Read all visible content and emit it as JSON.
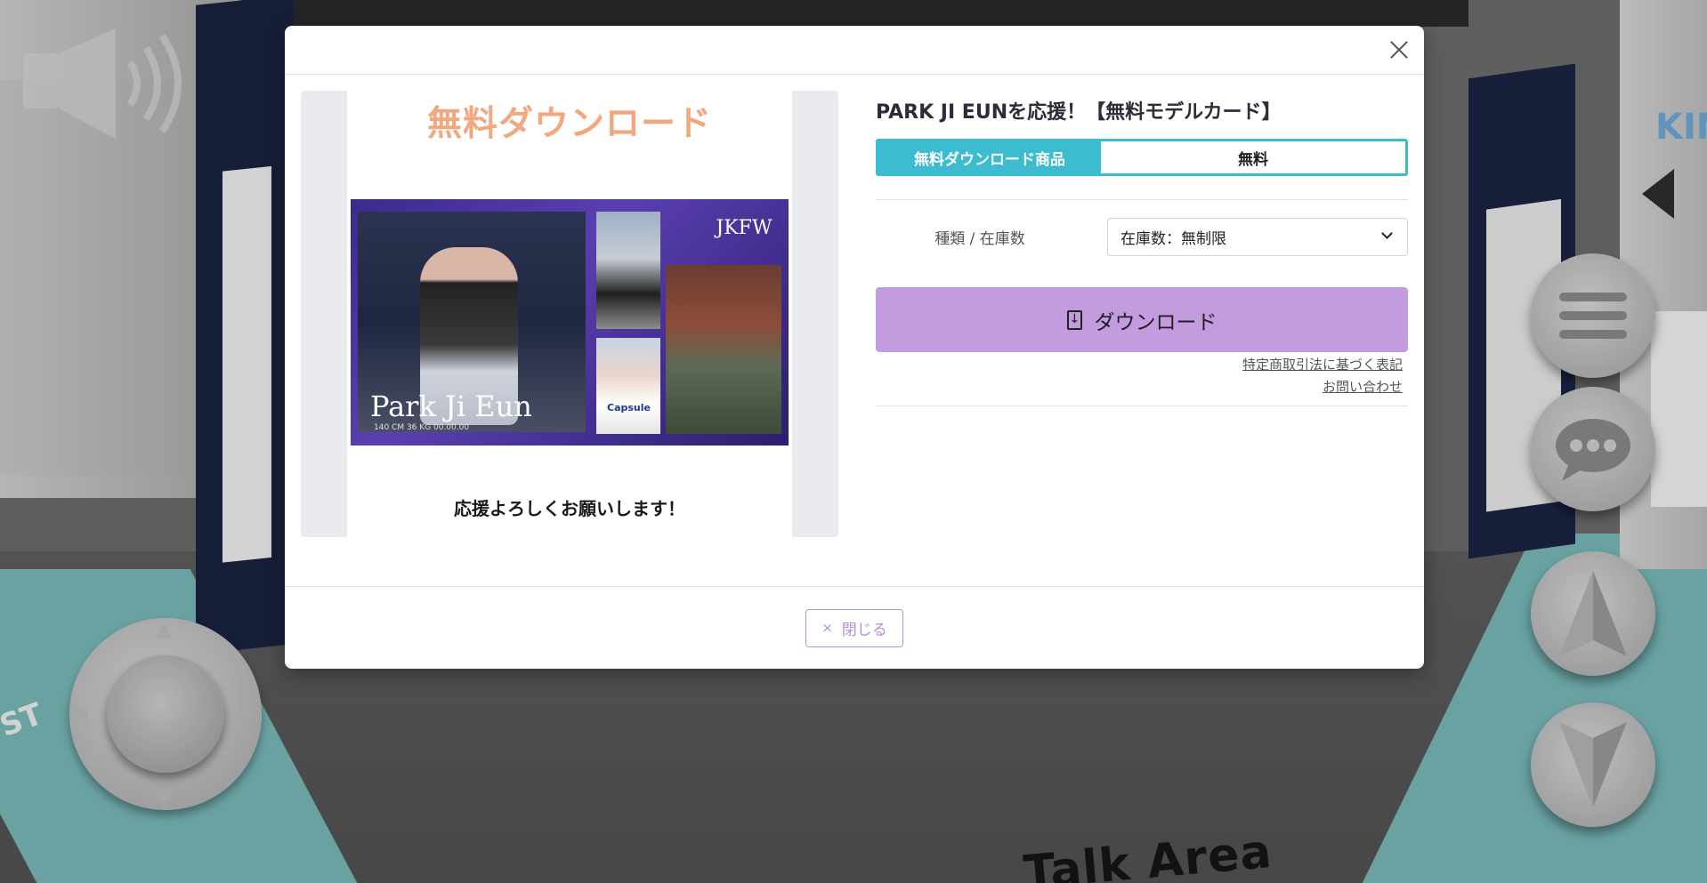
{
  "scene": {
    "talk_area_label": "Talk Area",
    "corner_label": "ST",
    "sign_label": "KIM"
  },
  "modal": {
    "product_title": "PARK JI EUNを応援！【無料モデルカード】",
    "type_badge": "無料ダウンロード商品",
    "price_label": "無料",
    "stock_label": "種類 / 在庫数",
    "stock_selected": "在庫数：無制限",
    "download_label": "ダウンロード",
    "legal_link": "特定商取引法に基づく表記",
    "contact_link": "お問い合わせ",
    "close_label": "閉じる",
    "close_x_glyph": "×"
  },
  "product_image": {
    "top_text": "無料ダウンロード",
    "name_text": "Park Ji Eun",
    "meta_text": "140 CM 36 KG 00.00.00",
    "brand_text": "JKFW",
    "capsule_text": "Capsule",
    "bottom_text": "応援よろしくお願いします！"
  },
  "colors": {
    "accent_teal": "#3bbccf",
    "download_purple": "#c39ce0",
    "close_purple": "#b98fd8",
    "card_orange_text": "#f2a77e"
  },
  "icons": {
    "speaker": "speaker-icon",
    "menu": "menu-icon",
    "chat": "chat-icon",
    "forward": "forward-arrow-icon",
    "back": "back-arrow-icon",
    "download": "document-download-icon",
    "close": "close-icon"
  }
}
